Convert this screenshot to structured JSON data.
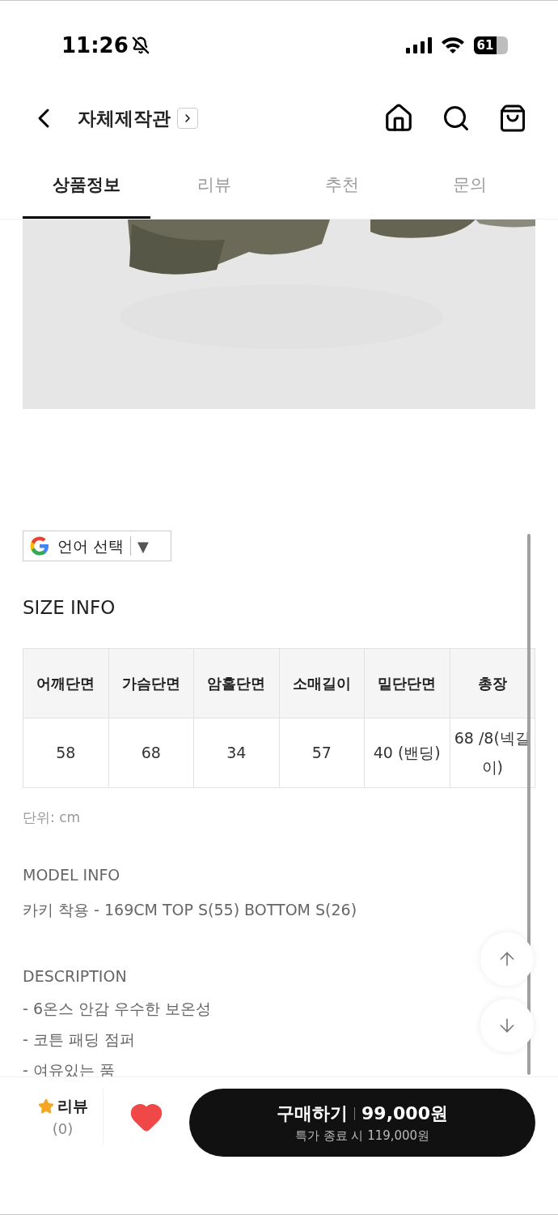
{
  "status_bar": {
    "time": "11:26",
    "battery": "61"
  },
  "header": {
    "title": "자체제작관"
  },
  "tabs": [
    {
      "label": "상품정보",
      "selected": true
    },
    {
      "label": "리뷰",
      "selected": false
    },
    {
      "label": "추천",
      "selected": false
    },
    {
      "label": "문의",
      "selected": false
    }
  ],
  "translate": {
    "label": "언어 선택",
    "arrow": "▼"
  },
  "size_info": {
    "title": "SIZE INFO",
    "columns": [
      "어깨단면",
      "가슴단면",
      "암홀단면",
      "소매길이",
      "밑단단면",
      "총장"
    ],
    "rows": [
      [
        "58",
        "68",
        "34",
        "57",
        "40 (밴딩)",
        "68 /8(넥길이)"
      ]
    ],
    "unit": "단위: cm"
  },
  "model_info": {
    "title": "MODEL INFO",
    "text": "카키 착용 - 169CM TOP S(55) BOTTOM S(26)"
  },
  "description": {
    "title": "DESCRIPTION",
    "lines": [
      "- 6온스 안감 우수한 보온성",
      "- 코튼 패딩 점퍼",
      "- 여유있는 품"
    ]
  },
  "bottom_bar": {
    "review_label": "리뷰",
    "review_count": "(0)",
    "liked": true,
    "buy_label": "구매하기",
    "price": "99,000원",
    "original_price_note": "특가 종료 시 119,000원"
  }
}
